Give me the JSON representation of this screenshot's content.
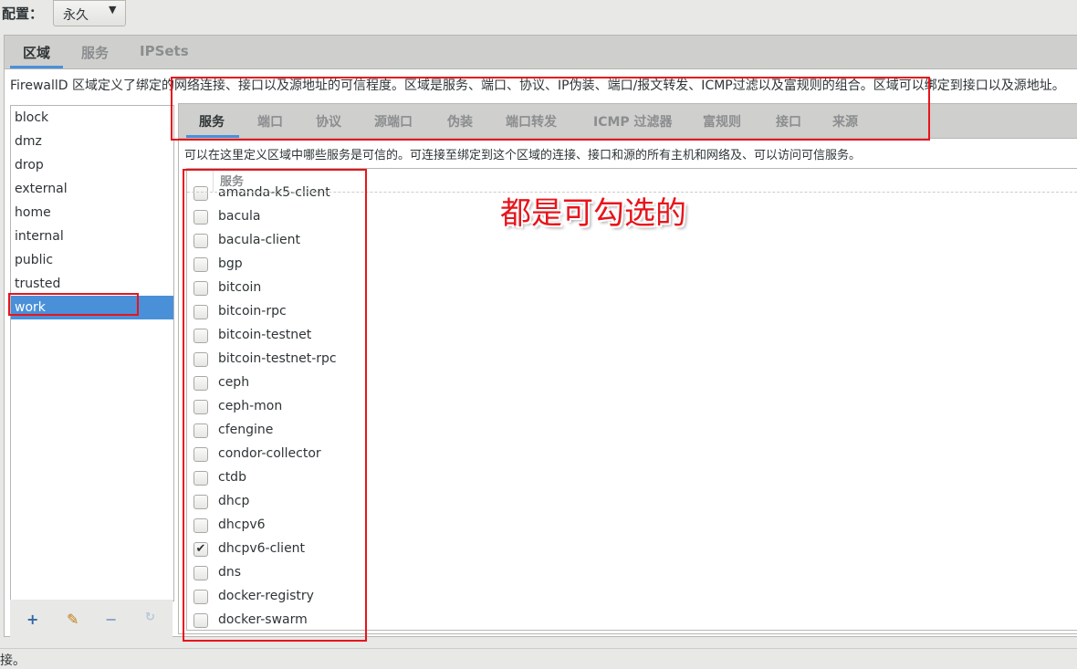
{
  "config": {
    "label": "配置：",
    "value": "永久"
  },
  "outer_tabs": [
    "区域",
    "服务",
    "IPSets"
  ],
  "zone_description": "FirewallD 区域定义了绑定的网络连接、接口以及源地址的可信程度。区域是服务、端口、协议、IP伪装、端口/报文转发、ICMP过滤以及富规则的组合。区域可以绑定到接口以及源地址。",
  "zones": [
    "block",
    "dmz",
    "drop",
    "external",
    "home",
    "internal",
    "public",
    "trusted",
    "work"
  ],
  "selected_zone": "work",
  "zone_tools": {
    "add": "+",
    "edit": "✎",
    "remove": "−",
    "reload": "↻"
  },
  "inner_tabs": [
    "服务",
    "端口",
    "协议",
    "源端口",
    "伪装",
    "端口转发",
    "ICMP 过滤器",
    "富规则",
    "接口",
    "来源"
  ],
  "services_description": "可以在这里定义区域中哪些服务是可信的。可连接至绑定到这个区域的连接、接口和源的所有主机和网络及、可以访问可信服务。",
  "services_header": "服务",
  "services": [
    {
      "name": "amanda-k5-client",
      "checked": false
    },
    {
      "name": "bacula",
      "checked": false
    },
    {
      "name": "bacula-client",
      "checked": false
    },
    {
      "name": "bgp",
      "checked": false
    },
    {
      "name": "bitcoin",
      "checked": false
    },
    {
      "name": "bitcoin-rpc",
      "checked": false
    },
    {
      "name": "bitcoin-testnet",
      "checked": false
    },
    {
      "name": "bitcoin-testnet-rpc",
      "checked": false
    },
    {
      "name": "ceph",
      "checked": false
    },
    {
      "name": "ceph-mon",
      "checked": false
    },
    {
      "name": "cfengine",
      "checked": false
    },
    {
      "name": "condor-collector",
      "checked": false
    },
    {
      "name": "ctdb",
      "checked": false
    },
    {
      "name": "dhcp",
      "checked": false
    },
    {
      "name": "dhcpv6",
      "checked": false
    },
    {
      "name": "dhcpv6-client",
      "checked": true
    },
    {
      "name": "dns",
      "checked": false
    },
    {
      "name": "docker-registry",
      "checked": false
    },
    {
      "name": "docker-swarm",
      "checked": false
    }
  ],
  "status_text": "接。",
  "annotation": "都是可勾选的",
  "colors": {
    "accent": "#4a90d9",
    "annotation": "#e8141c"
  }
}
